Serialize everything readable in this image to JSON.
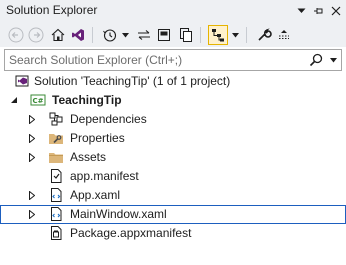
{
  "window": {
    "title": "Solution Explorer"
  },
  "titlebar_buttons": {
    "dropdown": "▾",
    "pin": "pin-icon",
    "close": "×"
  },
  "search": {
    "placeholder": "Search Solution Explorer (Ctrl+;)",
    "value": ""
  },
  "tree": {
    "solution": {
      "label": "Solution 'TeachingTip' (1 of 1 project)"
    },
    "project": {
      "label": "TeachingTip",
      "badge": "C#"
    },
    "items": [
      {
        "label": "Dependencies",
        "icon": "dependencies-icon"
      },
      {
        "label": "Properties",
        "icon": "wrench-folder-icon"
      },
      {
        "label": "Assets",
        "icon": "folder-icon"
      },
      {
        "label": "app.manifest",
        "icon": "manifest-file-icon"
      },
      {
        "label": "App.xaml",
        "icon": "xaml-file-icon"
      },
      {
        "label": "MainWindow.xaml",
        "icon": "xaml-file-icon"
      },
      {
        "label": "Package.appxmanifest",
        "icon": "appxmanifest-icon"
      }
    ]
  },
  "colors": {
    "accent": "#1d5fbf",
    "header_bg": "#eef0f3",
    "pressed_bg": "#fff1cc",
    "folder": "#dcb67a",
    "csharp": "#388a34"
  }
}
